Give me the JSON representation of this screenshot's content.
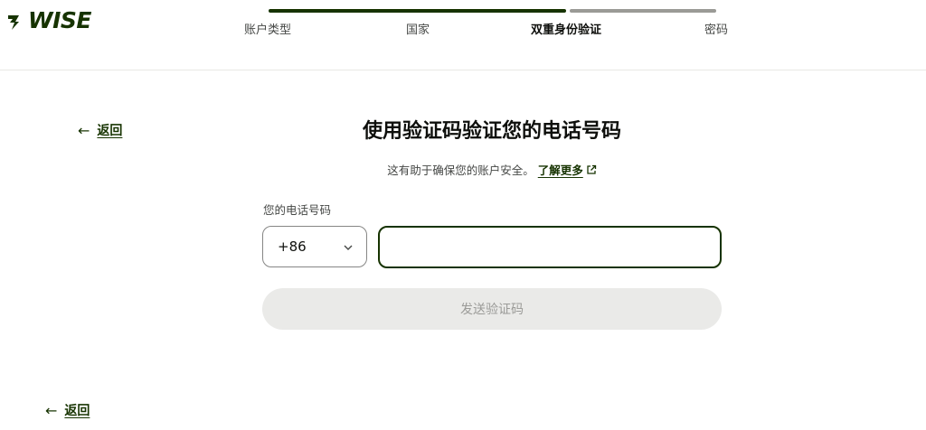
{
  "brand": {
    "logo_text": "WISE",
    "logo_icon": "wise-flag-icon"
  },
  "colors": {
    "primary": "#163300",
    "progress_done": "#163300",
    "progress_todo": "#9a9a96",
    "button_disabled_bg": "#eaeae8",
    "button_disabled_text": "#9b9b98"
  },
  "stepper": {
    "steps": [
      {
        "label": "账户类型",
        "state": "done"
      },
      {
        "label": "国家",
        "state": "done"
      },
      {
        "label": "双重身份验证",
        "state": "current"
      },
      {
        "label": "密码",
        "state": "upcoming"
      }
    ]
  },
  "nav": {
    "back_label": "返回",
    "back_icon": "arrow-left-icon"
  },
  "main": {
    "title": "使用验证码验证您的电话号码",
    "subtitle": "这有助于确保您的账户安全。",
    "learn_more_label": "了解更多",
    "learn_more_icon": "external-link-icon"
  },
  "form": {
    "phone_label": "您的电话号码",
    "country_code": "+86",
    "phone_value": "",
    "phone_placeholder": "",
    "send_button_label": "发送验证码",
    "send_button_enabled": false
  }
}
